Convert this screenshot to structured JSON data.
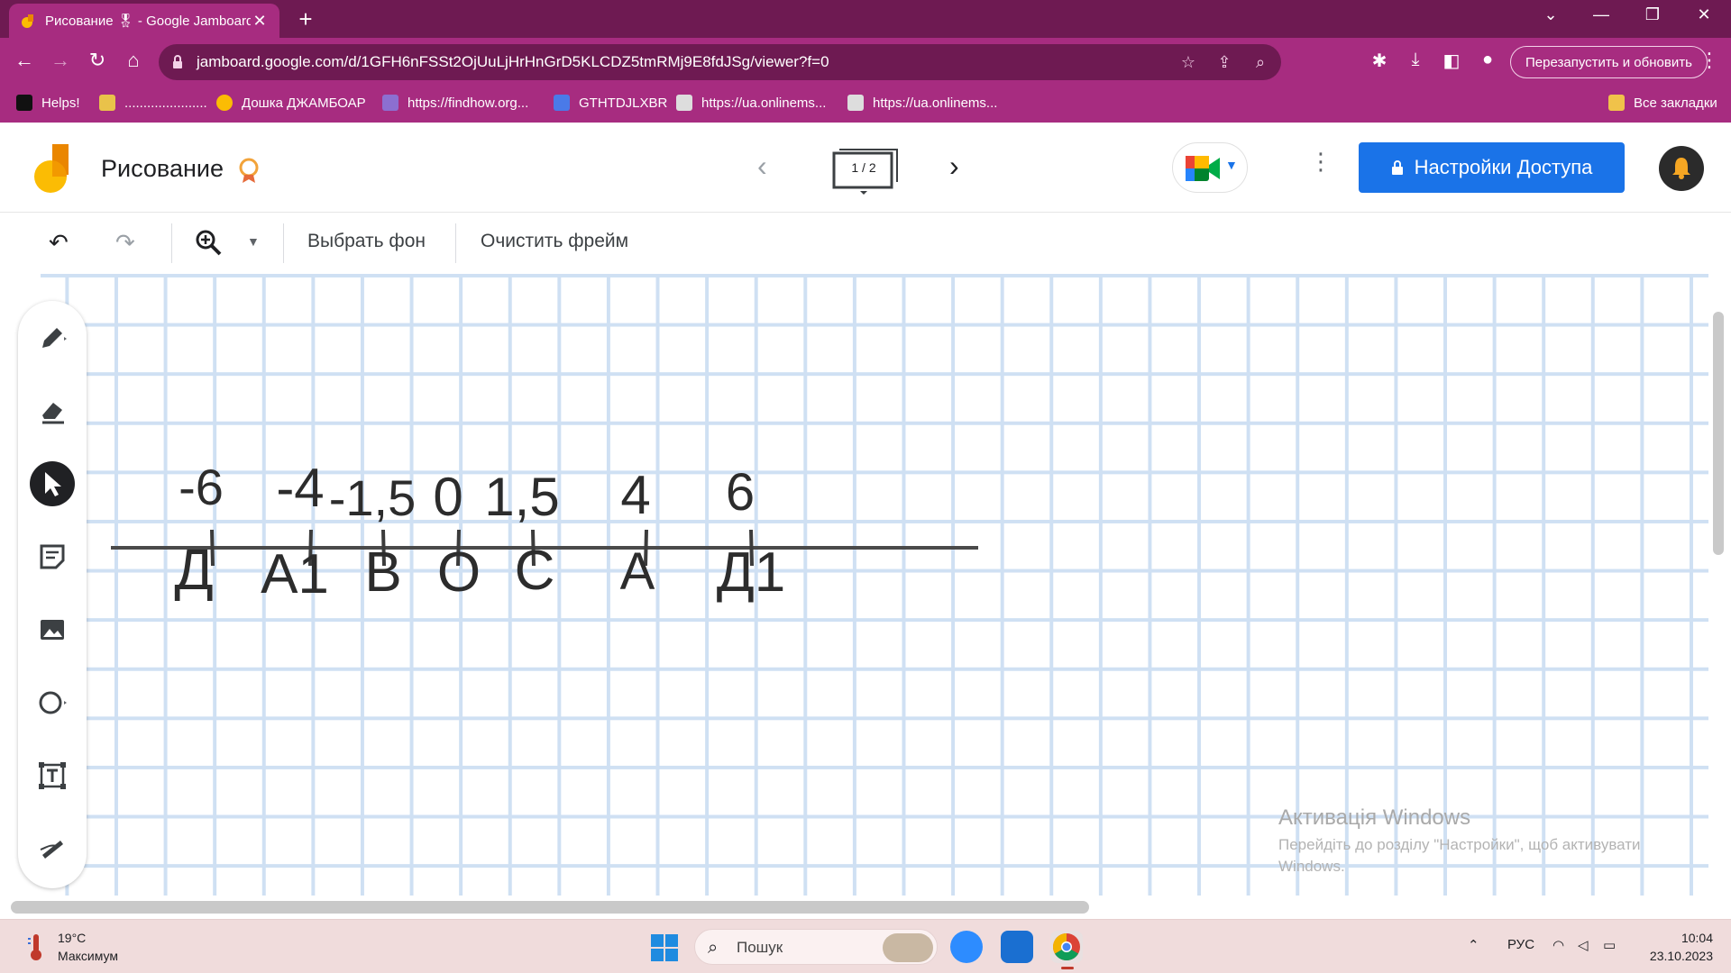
{
  "browser": {
    "tab_title": "Рисование 🎖 - Google Jamboard",
    "tab_close": "✕",
    "new_tab": "+",
    "url": "jamboard.google.com/d/1GFH6nFSSt2OjUuLjHrHnGrD5KLCDZ5tmRMj9E8fdJSg/viewer?f=0",
    "relaunch_label": "Перезапустить и обновить",
    "bookmarks": [
      {
        "label": "Helps!"
      },
      {
        "label": "......................"
      },
      {
        "label": "Дошка ДЖАМБОАР"
      },
      {
        "label": "https://findhow.org..."
      },
      {
        "label": "GTHTDJLXBR"
      },
      {
        "label": "https://ua.onlinems..."
      },
      {
        "label": "https://ua.onlinems..."
      }
    ],
    "all_bookmarks": "Все закладки"
  },
  "jamboard": {
    "title": "Рисование",
    "frame_indicator": "1 / 2",
    "share_label": "Настройки Доступа",
    "choose_background": "Выбрать фон",
    "clear_frame": "Очистить фрейм"
  },
  "number_line": {
    "ticks": [
      {
        "value": "-6",
        "point": "Д"
      },
      {
        "value": "-4",
        "point": "А1"
      },
      {
        "value": "-1,5",
        "point": "В"
      },
      {
        "value": "0",
        "point": "О"
      },
      {
        "value": "1,5",
        "point": "С"
      },
      {
        "value": "4",
        "point": "А"
      },
      {
        "value": "6",
        "point": "Д1"
      }
    ]
  },
  "watermark": {
    "title": "Активація Windows",
    "subtitle": "Перейдіть до розділу \"Настройки\", щоб активувати Windows."
  },
  "taskbar": {
    "temperature": "19°C",
    "condition": "Максимум",
    "search_placeholder": "Пошук",
    "language": "РУС",
    "time": "10:04",
    "date": "23.10.2023"
  },
  "colors": {
    "browser_frame": "#6e1a52",
    "browser_toolbar": "#a72c80",
    "share_button": "#1a73e8",
    "grid_line": "#cfe0f3",
    "ink": "#2c2c2c"
  }
}
